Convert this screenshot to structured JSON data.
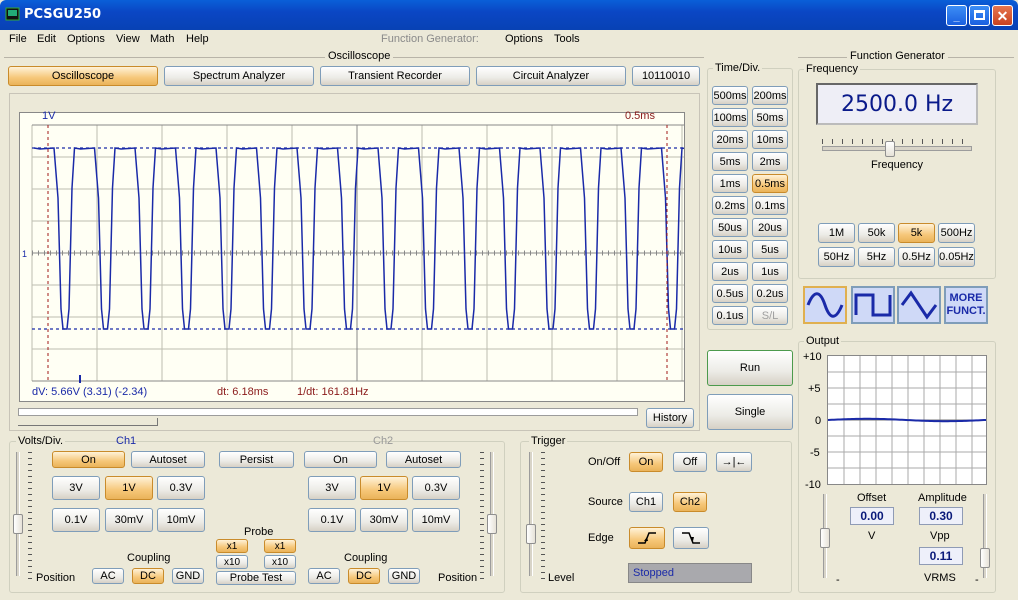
{
  "window": {
    "title": "PCSGU250"
  },
  "menu": {
    "left": [
      "File",
      "Edit",
      "Options",
      "View",
      "Math",
      "Help"
    ],
    "fg_label": "Function Generator:",
    "right": [
      "Options",
      "Tools"
    ]
  },
  "osc": {
    "section_title": "Oscilloscope",
    "tabs": [
      "Oscilloscope",
      "Spectrum Analyzer",
      "Transient Recorder",
      "Circuit Analyzer",
      "10110010"
    ],
    "scale_left": "1V",
    "scale_right": "0.5ms",
    "ch_marker": "1",
    "readout": {
      "dv": "dV: 5.66V  (3.31) (-2.34)",
      "dt": "dt: 6.18ms",
      "inv_dt": "1/dt: 161.81Hz"
    },
    "history_label": "History"
  },
  "timediv": {
    "title": "Time/Div.",
    "buttons": [
      "500ms",
      "200ms",
      "100ms",
      "50ms",
      "20ms",
      "10ms",
      "5ms",
      "2ms",
      "1ms",
      "0.5ms",
      "0.2ms",
      "0.1ms",
      "50us",
      "20us",
      "10us",
      "5us",
      "2us",
      "1us",
      "0.5us",
      "0.2us",
      "0.1us",
      "S/L"
    ],
    "selected": "0.5ms"
  },
  "run": {
    "run_label": "Run",
    "single_label": "Single"
  },
  "volts": {
    "title": "Volts/Div.",
    "ch1": {
      "name": "Ch1",
      "on": "On",
      "autoset": "Autoset",
      "v": [
        "3V",
        "1V",
        "0.3V",
        "0.1V",
        "30mV",
        "10mV"
      ],
      "selected": "1V",
      "coupling_label": "Coupling",
      "coupling": [
        "AC",
        "DC",
        "GND"
      ],
      "coupling_selected": "DC",
      "position_label": "Position"
    },
    "ch2": {
      "name": "Ch2",
      "on": "On",
      "autoset": "Autoset",
      "v": [
        "3V",
        "1V",
        "0.3V",
        "0.1V",
        "30mV",
        "10mV"
      ],
      "selected": "1V",
      "coupling_label": "Coupling",
      "coupling": [
        "AC",
        "DC",
        "GND"
      ],
      "coupling_selected": "DC",
      "position_label": "Position"
    },
    "persist_label": "Persist",
    "probe_label": "Probe",
    "probe": [
      "x1",
      "x1",
      "x10",
      "x10"
    ],
    "probe_test_label": "Probe Test"
  },
  "trigger": {
    "title": "Trigger",
    "onoff_label": "On/Off",
    "on": "On",
    "off": "Off",
    "onoff_selected": "On",
    "source_label": "Source",
    "sources": [
      "Ch1",
      "Ch2"
    ],
    "source_selected": "Ch2",
    "edge_label": "Edge",
    "level_label": "Level",
    "status": "Stopped"
  },
  "fg": {
    "section_title": "Function Generator",
    "frequency_title": "Frequency",
    "frequency_value": "2500.0 Hz",
    "frequency_slider_label": "Frequency",
    "range_buttons": [
      "1M",
      "50k",
      "5k",
      "500Hz",
      "50Hz",
      "5Hz",
      "0.5Hz",
      "0.05Hz"
    ],
    "range_selected": "5k",
    "more_label_1": "MORE",
    "more_label_2": "FUNCT.",
    "output_title": "Output",
    "output_ticks": [
      "+10",
      "+5",
      "0",
      "-5",
      "-10"
    ],
    "offset_label": "Offset",
    "offset_value": "0.00",
    "offset_unit": "V",
    "amplitude_label": "Amplitude",
    "amplitude_value": "0.30",
    "amplitude_unit": "Vpp",
    "vrms_value": "0.11",
    "vrms_unit": "VRMS"
  },
  "colors": {
    "trace": "#1a2aa8",
    "cursor": "#a01818",
    "selected": "#f6c779"
  }
}
